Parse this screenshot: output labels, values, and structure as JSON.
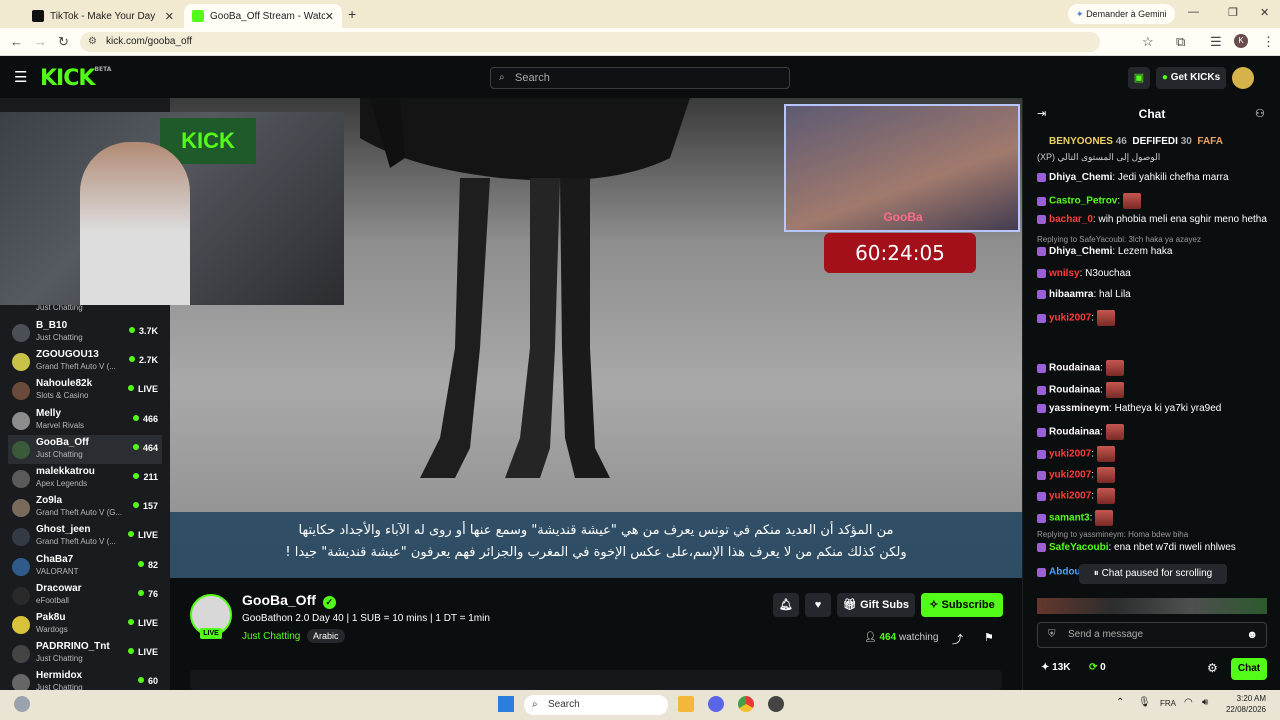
{
  "browser": {
    "tabs": [
      {
        "label": "TikTok - Make Your Day",
        "fav_color": "#111111"
      },
      {
        "label": "GooBa_Off Stream - Watch Live",
        "fav_color": "#53fc18"
      }
    ],
    "gemini_label": "Demander à Gemini",
    "url": "kick.com/gooba_off"
  },
  "header": {
    "logo": "KICK",
    "logo_beta": "BETA",
    "search_placeholder": "Search",
    "get_kicks_label": "Get KICKs"
  },
  "sidebar": {
    "top_partial_category": "Just Chatting",
    "channels": [
      {
        "name": "B_B10",
        "category": "Just Chatting",
        "viewers": "3.7K",
        "avatar_color": "#4a4f55"
      },
      {
        "name": "ZGOUGOU13",
        "category": "Grand Theft Auto V (...",
        "viewers": "2.7K",
        "avatar_color": "#c9c248"
      },
      {
        "name": "Nahoule82k",
        "category": "Slots & Casino",
        "viewers": "LIVE",
        "avatar_color": "#6a4a3a"
      },
      {
        "name": "Melly",
        "category": "Marvel Rivals",
        "viewers": "466",
        "avatar_color": "#8c8c8c"
      },
      {
        "name": "GooBa_Off",
        "category": "Just Chatting",
        "viewers": "464",
        "avatar_color": "#3a5a3a"
      },
      {
        "name": "malekkatrou",
        "category": "Apex Legends",
        "viewers": "211",
        "avatar_color": "#5a5a5a"
      },
      {
        "name": "Zo9la",
        "category": "Grand Theft Auto V (G...",
        "viewers": "157",
        "avatar_color": "#7a6a5a"
      },
      {
        "name": "Ghost_jeen",
        "category": "Grand Theft Auto V (...",
        "viewers": "LIVE",
        "avatar_color": "#333a44"
      },
      {
        "name": "ChaBa7",
        "category": "VALORANT",
        "viewers": "82",
        "avatar_color": "#2f5a8a"
      },
      {
        "name": "Dracowar",
        "category": "eFootball",
        "viewers": "76",
        "avatar_color": "#2a2a2a"
      },
      {
        "name": "Pak8u",
        "category": "Wardogs",
        "viewers": "LIVE",
        "avatar_color": "#d8c23a"
      },
      {
        "name": "PADRRINO_Tnt",
        "category": "Just Chatting",
        "viewers": "LIVE",
        "avatar_color": "#444444"
      },
      {
        "name": "Hermidox",
        "category": "Just Chatting",
        "viewers": "60",
        "avatar_color": "#666666"
      }
    ]
  },
  "video": {
    "subtitle_line1": "من المؤكد أن العديد منكم في تونس يعرف من هي \"عيشة قنديشة\" وسمع عنها أو روى له الآباء والأجداد حكايتها",
    "subtitle_line2": "ولكن كذلك منكم من لا يعرف هذا الإسم،على عكس الإخوة في المغرب والجزائر فهم يعرفون \"عيشة قنديشة\" جيدا !",
    "overlay_name": "GooBa",
    "timer": "60:24:05"
  },
  "stream": {
    "streamer": "GooBa_Off",
    "title": "GooBathon 2.0 Day 40 | 1 SUB = 10 mins | 1 DT = 1min",
    "category": "Just Chatting",
    "tag": "Arabic",
    "live_label": "LIVE",
    "gift_subs_label": "Gift Subs",
    "subscribe_label": "Subscribe",
    "viewers": "464",
    "watching_label": "watching"
  },
  "chat": {
    "title": "Chat",
    "pinned": [
      {
        "name": "BENYOONES",
        "count": "46"
      },
      {
        "name": "DEFIFEDI",
        "count": "30"
      },
      {
        "name": "FAFA",
        "count": ""
      }
    ],
    "xp_line": "(XP) الوصول إلى المستوى التالي",
    "messages": [
      {
        "user": "Dhiya_Chemi",
        "text": "Jedi yahkili chefha marra",
        "color": "#ffffff"
      },
      {
        "user": "Castro_Petrov",
        "text": "",
        "color": "#53fc18"
      },
      {
        "user": "bachar_0",
        "text": "wih phobia meli ena sghir meno hetha",
        "color": "#ff3b3b"
      },
      {
        "user": "Dhiya_Chemi",
        "text": "Lezem haka",
        "color": "#ffffff"
      },
      {
        "user": "wnilsy",
        "text": "N3ouchaa",
        "color": "#ff3b3b"
      },
      {
        "user": "hibaamra",
        "text": "hal Lila",
        "color": "#ffffff"
      },
      {
        "user": "yuki2007",
        "text": "",
        "color": "#ff3b3b"
      },
      {
        "user": "Roudainaa",
        "text": "",
        "color": "#ffffff"
      },
      {
        "user": "Roudainaa",
        "text": "",
        "color": "#ffffff"
      },
      {
        "user": "yassmineym",
        "text": "Hatheya ki ya7ki yra9ed",
        "color": "#ffffff"
      },
      {
        "user": "Roudainaa",
        "text": "",
        "color": "#ffffff"
      },
      {
        "user": "yuki2007",
        "text": "",
        "color": "#ff3b3b"
      },
      {
        "user": "yuki2007",
        "text": "",
        "color": "#ff3b3b"
      },
      {
        "user": "yuki2007",
        "text": "",
        "color": "#ff3b3b"
      },
      {
        "user": "samant3",
        "text": "",
        "color": "#53fc18"
      },
      {
        "user": "SafeYacoubi",
        "text": "ena nbet w7di nweli nhlwes",
        "color": "#53fc18"
      },
      {
        "user": "Abdou",
        "text": "",
        "color": "#4aa3ff"
      }
    ],
    "reply1": "Replying to SafeYacoubi: 3lch haka ya azayez",
    "reply2": "Replying to yassmineym: Homa bdew biha",
    "paused_label": "Chat paused for scrolling",
    "input_placeholder": "Send a message",
    "kicks_count": "13K",
    "points": "0",
    "chat_button": "Chat"
  },
  "taskbar": {
    "search_placeholder": "Search",
    "lang": "FRA",
    "time": "3:20 AM",
    "date": "22/08/2026"
  }
}
